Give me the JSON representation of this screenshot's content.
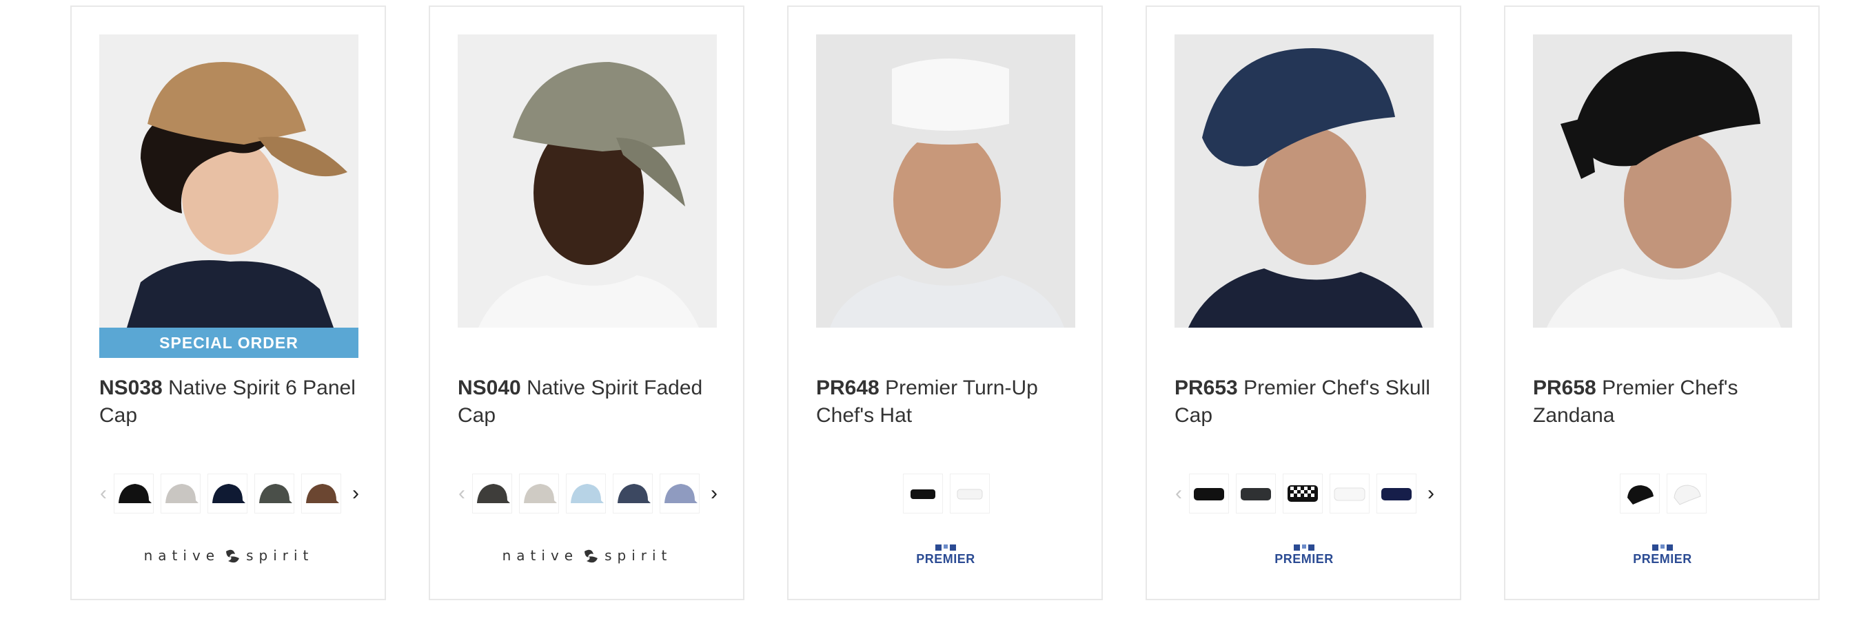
{
  "products": [
    {
      "code": "NS038",
      "name": "Native Spirit 6 Panel Cap",
      "badge": "SPECIAL ORDER",
      "brand": "native spirit",
      "swatches": [
        "#111111",
        "#c9c6c2",
        "#0f1a33",
        "#4a4f49",
        "#6b4631",
        "#7a1a16"
      ],
      "has_arrows": true
    },
    {
      "code": "NS040",
      "name": "Native Spirit Faded Cap",
      "badge": "",
      "brand": "native spirit",
      "swatches": [
        "#3e3d3a",
        "#cfcbc4",
        "#b7d3e6",
        "#3c4861",
        "#8f9bc0",
        "#cfcbc4"
      ],
      "has_arrows": true
    },
    {
      "code": "PR648",
      "name": "Premier Turn-Up Chef's Hat",
      "badge": "",
      "brand": "PREMIER",
      "swatches": [
        "#111111",
        "#ffffff"
      ],
      "has_arrows": false
    },
    {
      "code": "PR653",
      "name": "Premier Chef's Skull Cap",
      "badge": "",
      "brand": "PREMIER",
      "swatches": [
        "#111111",
        "#2f3133",
        "checker",
        "#ffffff",
        "#161e4a",
        "#cccccc"
      ],
      "has_arrows": true
    },
    {
      "code": "PR658",
      "name": "Premier Chef's Zandana",
      "badge": "",
      "brand": "PREMIER",
      "swatches": [
        "#111111",
        "#ffffff"
      ],
      "has_arrows": false
    }
  ],
  "arrow_prev": "‹",
  "arrow_next": "›",
  "colors": {
    "badge": "#5aa7d4",
    "premier_blue": "#2b4b93"
  }
}
